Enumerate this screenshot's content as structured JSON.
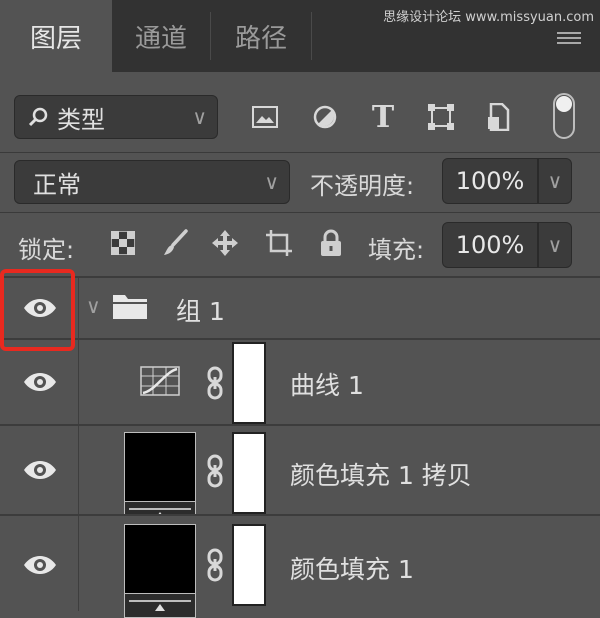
{
  "tabs": [
    {
      "label": "图层",
      "active": true
    },
    {
      "label": "通道",
      "active": false
    },
    {
      "label": "路径",
      "active": false
    }
  ],
  "watermark": "思缘设计论坛 www.missyuan.com",
  "filter": {
    "label": "类型"
  },
  "blend": {
    "mode": "正常",
    "opacity_label": "不透明度:",
    "opacity_value": "100%"
  },
  "lock": {
    "label": "锁定:",
    "fill_label": "填充:",
    "fill_value": "100%"
  },
  "layers": [
    {
      "name": "组 1",
      "type": "group"
    },
    {
      "name": "曲线 1",
      "type": "adjustment-curves"
    },
    {
      "name": "颜色填充 1 拷贝",
      "type": "fill"
    },
    {
      "name": "颜色填充 1",
      "type": "fill"
    }
  ],
  "colors": {
    "panel": "#535353",
    "tabbar": "#323232",
    "highlight": "#e8291f"
  }
}
